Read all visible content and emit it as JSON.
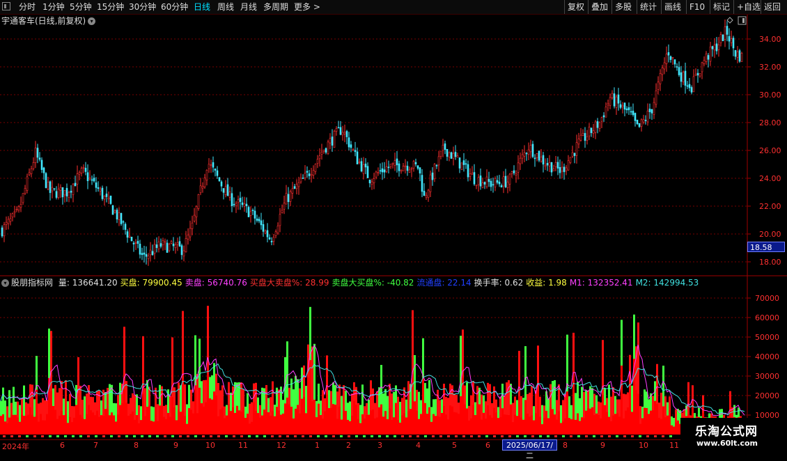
{
  "toolbar": {
    "periods": [
      "分时",
      "1分钟",
      "5分钟",
      "15分钟",
      "30分钟",
      "60分钟",
      "日线",
      "周线",
      "月线",
      "多周期",
      "更多 >"
    ],
    "active_period": "日线",
    "right_buttons": [
      "复权",
      "叠加",
      "多股",
      "统计",
      "画线",
      "F10",
      "标记",
      "+自选",
      "返回"
    ]
  },
  "main_chart": {
    "title": "宇通客车(日线,前复权)",
    "price_axis": [
      "34.00",
      "32.00",
      "30.00",
      "28.00",
      "26.00",
      "24.00",
      "22.00",
      "20.00",
      "18.00"
    ],
    "current_price": "18.58"
  },
  "indicator": {
    "name": "股朋指标网",
    "items": [
      {
        "label": "量: 136641.20",
        "color": "#e0e0e0"
      },
      {
        "label": "买盘: 79900.45",
        "color": "#ffff40"
      },
      {
        "label": "卖盘: 56740.76",
        "color": "#ff40ff"
      },
      {
        "label": "买盘大卖盘%: 28.99",
        "color": "#ff3030"
      },
      {
        "label": "卖盘大买盘%: -40.82",
        "color": "#40ff40"
      },
      {
        "label": "流通盘: 22.14",
        "color": "#2040ff"
      },
      {
        "label": "换手率: 0.62",
        "color": "#e0e0e0"
      },
      {
        "label": "收益: 1.98",
        "color": "#ffff40"
      },
      {
        "label": "M1: 132352.41",
        "color": "#ff40ff"
      },
      {
        "label": "M2: 142994.53",
        "color": "#40e0e0"
      }
    ],
    "volume_axis": [
      "70000",
      "60000",
      "50000",
      "40000",
      "30000",
      "20000",
      "10000"
    ]
  },
  "x_axis": {
    "labels": [
      "2024年",
      "6",
      "7",
      "8",
      "9",
      "10",
      "11",
      "12",
      "1",
      "2",
      "3",
      "4",
      "5",
      "6",
      "8",
      "9",
      "10",
      "11"
    ],
    "selected_date": "2025/06/17/二"
  },
  "watermark": {
    "title": "乐淘公式网",
    "url": "www.60lt.com"
  },
  "colors": {
    "up": "#ff3030",
    "down": "#40e8ff",
    "grid": "#7a0000",
    "vol_up": "#ff1010",
    "vol_down": "#40ff40"
  }
}
